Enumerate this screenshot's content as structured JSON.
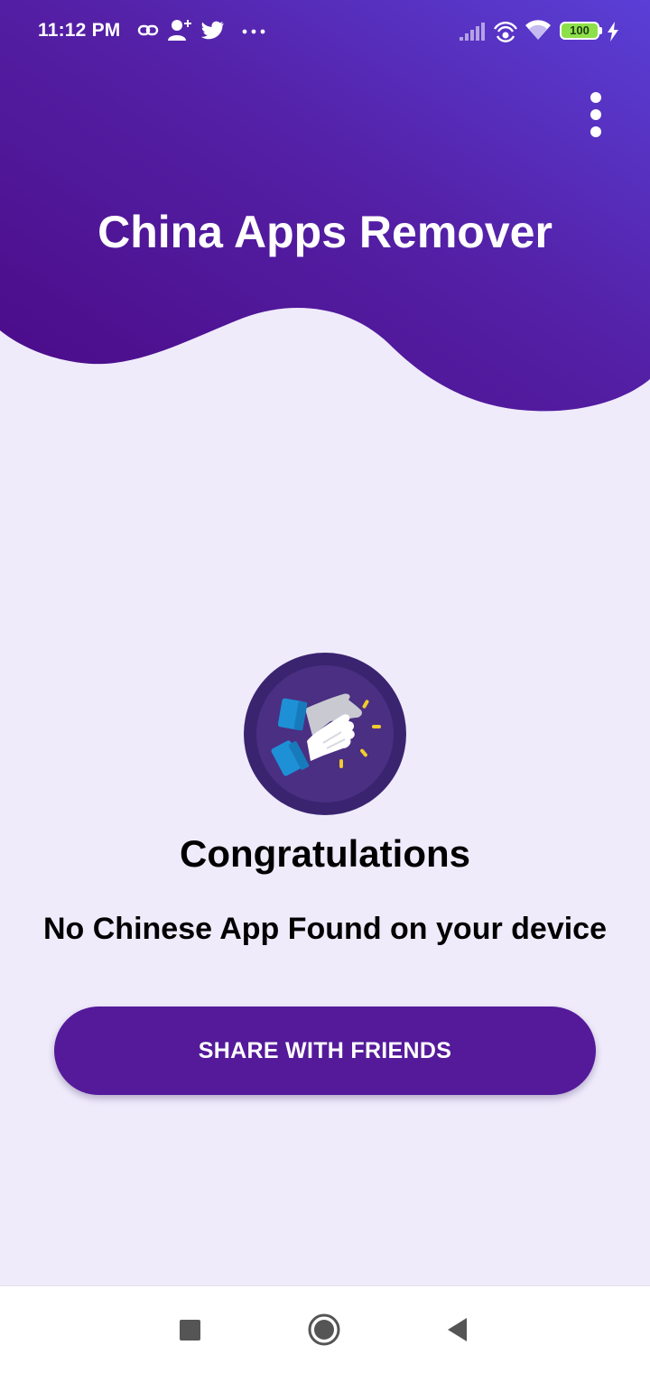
{
  "status_bar": {
    "time": "11:12 PM",
    "battery": "100",
    "icons": [
      "link-icon",
      "add-contact-icon",
      "twitter-icon",
      "more-notifications-icon",
      "signal-icon",
      "hotspot-icon",
      "wifi-icon",
      "battery-icon",
      "charging-icon"
    ]
  },
  "header": {
    "title": "China Apps Remover",
    "menu_icon": "more-vert-icon",
    "gradient": [
      "#4a0c8a",
      "#5a3bd3"
    ]
  },
  "main": {
    "badge_icon": "clapping-hands-icon",
    "congrats": "Congratulations",
    "message": "No Chinese App Found on your device",
    "share_label": "SHARE WITH FRIENDS"
  },
  "nav": {
    "icons": [
      "recents-icon",
      "home-icon",
      "back-icon"
    ]
  },
  "colors": {
    "background": "#efebfb",
    "accent": "#541a9a",
    "badge": "#3a2470"
  }
}
